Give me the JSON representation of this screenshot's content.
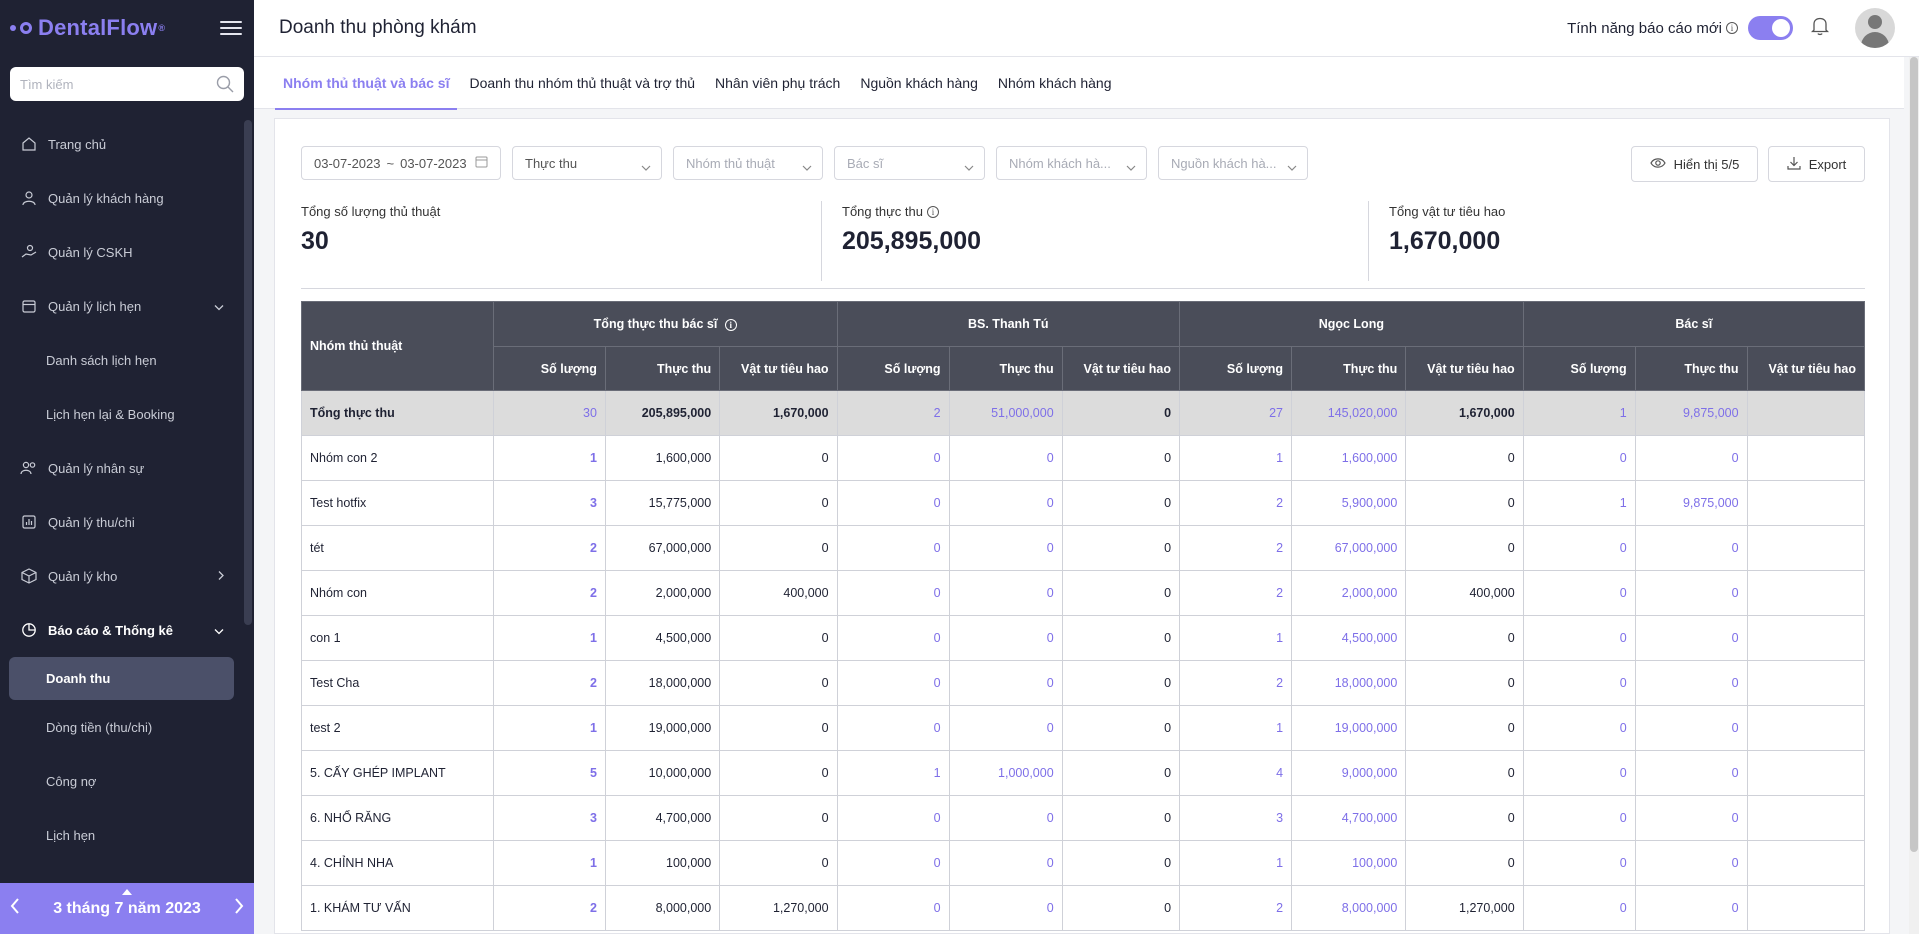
{
  "sidebar": {
    "logo": "DentalFlow",
    "logo_mark": "®",
    "search_placeholder": "Tìm kiếm",
    "items": [
      {
        "label": "Trang chủ"
      },
      {
        "label": "Quản lý khách hàng"
      },
      {
        "label": "Quản lý CSKH"
      },
      {
        "label": "Quản lý lịch hẹn"
      },
      {
        "label": "Danh sách lịch hẹn"
      },
      {
        "label": "Lịch hẹn lại & Booking"
      },
      {
        "label": "Quản lý nhân sự"
      },
      {
        "label": "Quản lý thu/chi"
      },
      {
        "label": "Quản lý kho"
      },
      {
        "label": "Báo cáo & Thống kê"
      },
      {
        "label": "Doanh thu"
      },
      {
        "label": "Dòng tiền (thu/chi)"
      },
      {
        "label": "Công nợ"
      },
      {
        "label": "Lịch hẹn"
      }
    ],
    "date_label": "3 tháng 7 năm 2023"
  },
  "header": {
    "title": "Doanh thu phòng khám",
    "feature_label": "Tính năng báo cáo mới",
    "toggle_on": true
  },
  "tabs": [
    {
      "label": "Nhóm thủ thuật và bác sĩ"
    },
    {
      "label": "Doanh thu nhóm thủ thuật và trợ thủ"
    },
    {
      "label": "Nhân viên phụ trách"
    },
    {
      "label": "Nguồn khách hàng"
    },
    {
      "label": "Nhóm khách hàng"
    }
  ],
  "filters": {
    "date_from": "03-07-2023",
    "date_sep": "~",
    "date_to": "03-07-2023",
    "type": "Thực thu",
    "procedure_group_ph": "Nhóm thủ thuật",
    "doctor_ph": "Bác sĩ",
    "customer_group_ph": "Nhóm khách hà...",
    "customer_source_ph": "Nguồn khách hà...",
    "display_btn": "Hiển thị 5/5",
    "export_btn": "Export"
  },
  "summary": {
    "procedures_label": "Tổng số lượng thủ thuật",
    "procedures_value": "30",
    "revenue_label": "Tổng thực thu",
    "revenue_value": "205,895,000",
    "supplies_label": "Tổng vật tư tiêu hao",
    "supplies_value": "1,670,000"
  },
  "table": {
    "group_col": "Nhóm thủ thuật",
    "groups": [
      "Tổng thực thu bác sĩ",
      "BS. Thanh Tú",
      "Ngọc Long",
      "Bác sĩ"
    ],
    "sub_cols": [
      "Số lượng",
      "Thực thu",
      "Vật tư tiêu hao"
    ],
    "rows": [
      {
        "name": "Tổng thực thu",
        "v": [
          "30",
          "205,895,000",
          "1,670,000",
          "2",
          "51,000,000",
          "0",
          "27",
          "145,020,000",
          "1,670,000",
          "1",
          "9,875,000"
        ]
      },
      {
        "name": "Nhóm con 2",
        "v": [
          "1",
          "1,600,000",
          "0",
          "0",
          "0",
          "0",
          "1",
          "1,600,000",
          "0",
          "0",
          "0"
        ]
      },
      {
        "name": "Test hotfix",
        "v": [
          "3",
          "15,775,000",
          "0",
          "0",
          "0",
          "0",
          "2",
          "5,900,000",
          "0",
          "1",
          "9,875,000"
        ]
      },
      {
        "name": "tét",
        "v": [
          "2",
          "67,000,000",
          "0",
          "0",
          "0",
          "0",
          "2",
          "67,000,000",
          "0",
          "0",
          "0"
        ]
      },
      {
        "name": "Nhóm con",
        "v": [
          "2",
          "2,000,000",
          "400,000",
          "0",
          "0",
          "0",
          "2",
          "2,000,000",
          "400,000",
          "0",
          "0"
        ]
      },
      {
        "name": "con 1",
        "v": [
          "1",
          "4,500,000",
          "0",
          "0",
          "0",
          "0",
          "1",
          "4,500,000",
          "0",
          "0",
          "0"
        ]
      },
      {
        "name": "Test Cha",
        "v": [
          "2",
          "18,000,000",
          "0",
          "0",
          "0",
          "0",
          "2",
          "18,000,000",
          "0",
          "0",
          "0"
        ]
      },
      {
        "name": "test 2",
        "v": [
          "1",
          "19,000,000",
          "0",
          "0",
          "0",
          "0",
          "1",
          "19,000,000",
          "0",
          "0",
          "0"
        ]
      },
      {
        "name": "5. CẤY GHÉP IMPLANT",
        "v": [
          "5",
          "10,000,000",
          "0",
          "1",
          "1,000,000",
          "0",
          "4",
          "9,000,000",
          "0",
          "0",
          "0"
        ]
      },
      {
        "name": "6. NHỔ RĂNG",
        "v": [
          "3",
          "4,700,000",
          "0",
          "0",
          "0",
          "0",
          "3",
          "4,700,000",
          "0",
          "0",
          "0"
        ]
      },
      {
        "name": "4. CHỈNH NHA",
        "v": [
          "1",
          "100,000",
          "0",
          "0",
          "0",
          "0",
          "1",
          "100,000",
          "0",
          "0",
          "0"
        ]
      },
      {
        "name": "1. KHÁM TƯ VẤN",
        "v": [
          "2",
          "8,000,000",
          "1,270,000",
          "0",
          "0",
          "0",
          "2",
          "8,000,000",
          "1,270,000",
          "0",
          "0"
        ]
      }
    ]
  },
  "colors": {
    "accent": "#8b7ff0",
    "sidebar_bg": "#1f2233",
    "table_header": "#4a4d59"
  }
}
